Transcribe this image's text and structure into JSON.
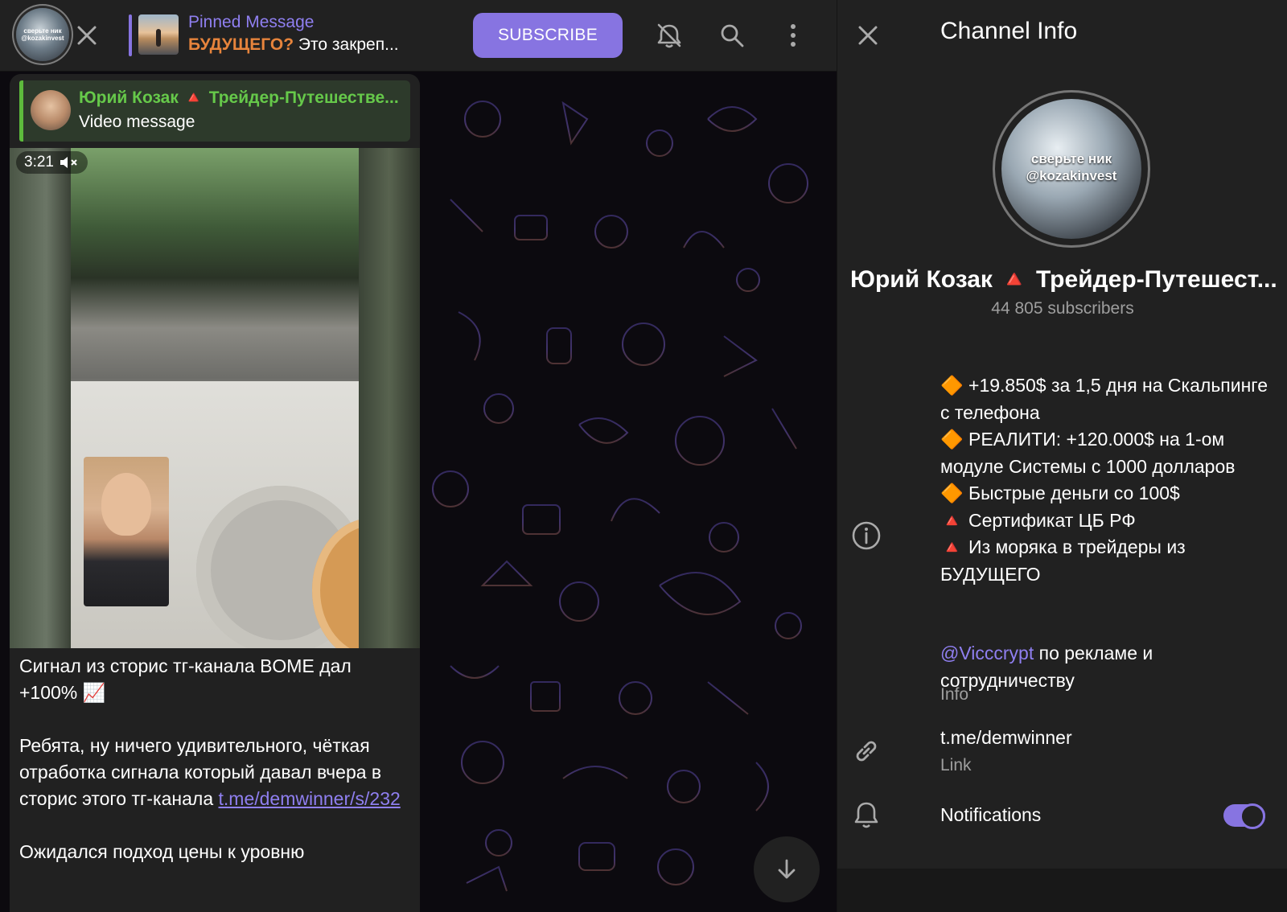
{
  "top_bar": {
    "avatar_text": "сверьте ник @kozakinvest",
    "pinned_title": "Pinned Message",
    "pinned_text_styled": "БУДУЩЕГО?",
    "pinned_text": "Это закреп...",
    "subscribe_label": "SUBSCRIBE"
  },
  "message": {
    "reply_name": "Юрий Козак",
    "reply_triangle": "🔺",
    "reply_name_rest": "Трейдер-Путешестве...",
    "reply_subtitle": "Video message",
    "video_duration": "3:21",
    "paragraph1": "Сигнал из сторис тг-канала BOME дал +100% 📈",
    "paragraph2_text": "Ребята,  ну ничего удивительного, чёткая отработка сигнала который давал вчера в сторис этого тг-канала",
    "paragraph2_link": "t.me/demwinner/s/232",
    "paragraph3": "Ожидался подход цены к уровню"
  },
  "info": {
    "title": "Channel Info",
    "avatar_text": "сверьте ник @kozakinvest",
    "channel_name_first": "Юрий Козак",
    "channel_triangle": "🔺",
    "channel_name_rest": "Трейдер-Путешест...",
    "subscribers": "44 805 subscribers",
    "about_lines": [
      {
        "icon": "🔶",
        "text": "+19.850$ за 1,5 дня на Скальпинге с телефона"
      },
      {
        "icon": "🔶",
        "text": "РЕАЛИТИ: +120.000$ на 1-ом модуле Системы с 1000 долларов"
      },
      {
        "icon": "🔶",
        "text": "Быстрые деньги со 100$"
      },
      {
        "icon": "🔺",
        "text": "Сертификат ЦБ РФ"
      },
      {
        "icon": "🔺",
        "text": "Из моряка в трейдеры из БУДУЩЕГО"
      }
    ],
    "contact_handle": "@Vicccrypt",
    "contact_text": "по рекламе и сотрудничеству",
    "info_label": "Info",
    "link_value": "t.me/demwinner",
    "link_label": "Link",
    "notifications_label": "Notifications",
    "notifications_enabled": true
  },
  "colors": {
    "accent": "#8774e1",
    "reply_green": "#66c94a",
    "red_triangle": "#e53935",
    "orange_diamond": "#f5a623"
  }
}
